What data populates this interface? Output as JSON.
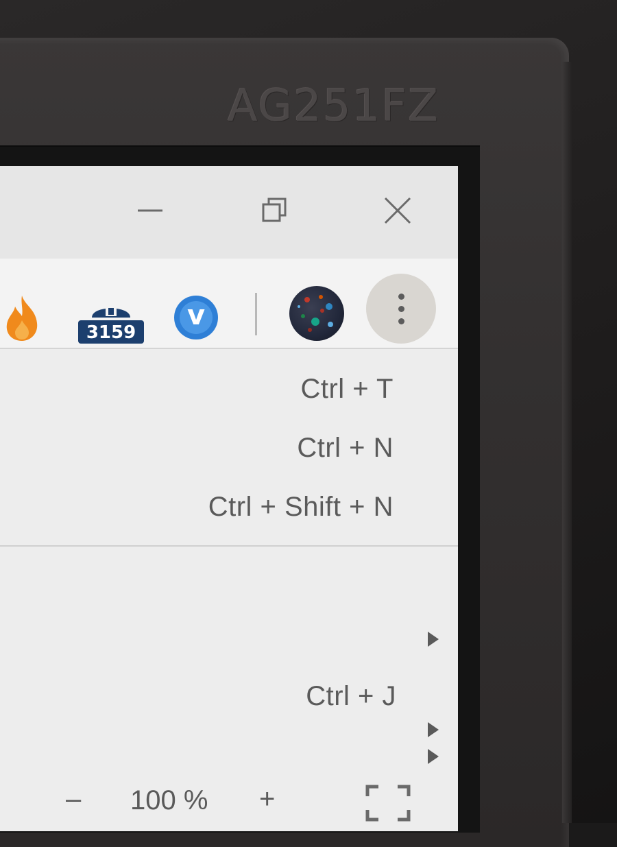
{
  "monitor": {
    "model_label": "AG251FZ"
  },
  "window_controls": {
    "minimize_icon": "minimize-icon",
    "restore_icon": "restore-icon",
    "close_icon": "close-icon"
  },
  "toolbar": {
    "extensions": [
      {
        "name": "fire-extension-icon"
      },
      {
        "name": "counter-extension-icon",
        "badge": "3159"
      },
      {
        "name": "v-extension-icon",
        "letter": "v"
      }
    ],
    "profile_avatar": "avatar-icon",
    "menu_icon": "more-vert-icon"
  },
  "menu": {
    "shortcuts": [
      "Ctrl + T",
      "Ctrl + N",
      "Ctrl + Shift + N"
    ],
    "downloads_shortcut": "Ctrl + J",
    "zoom": {
      "minus": "–",
      "value": "100 %",
      "plus": "+"
    }
  },
  "colors": {
    "badge_bg": "#1c3f6e",
    "v_badge": "#2e7fd6",
    "fire": "#f08a1c",
    "menu_text": "#5a5a5a"
  }
}
